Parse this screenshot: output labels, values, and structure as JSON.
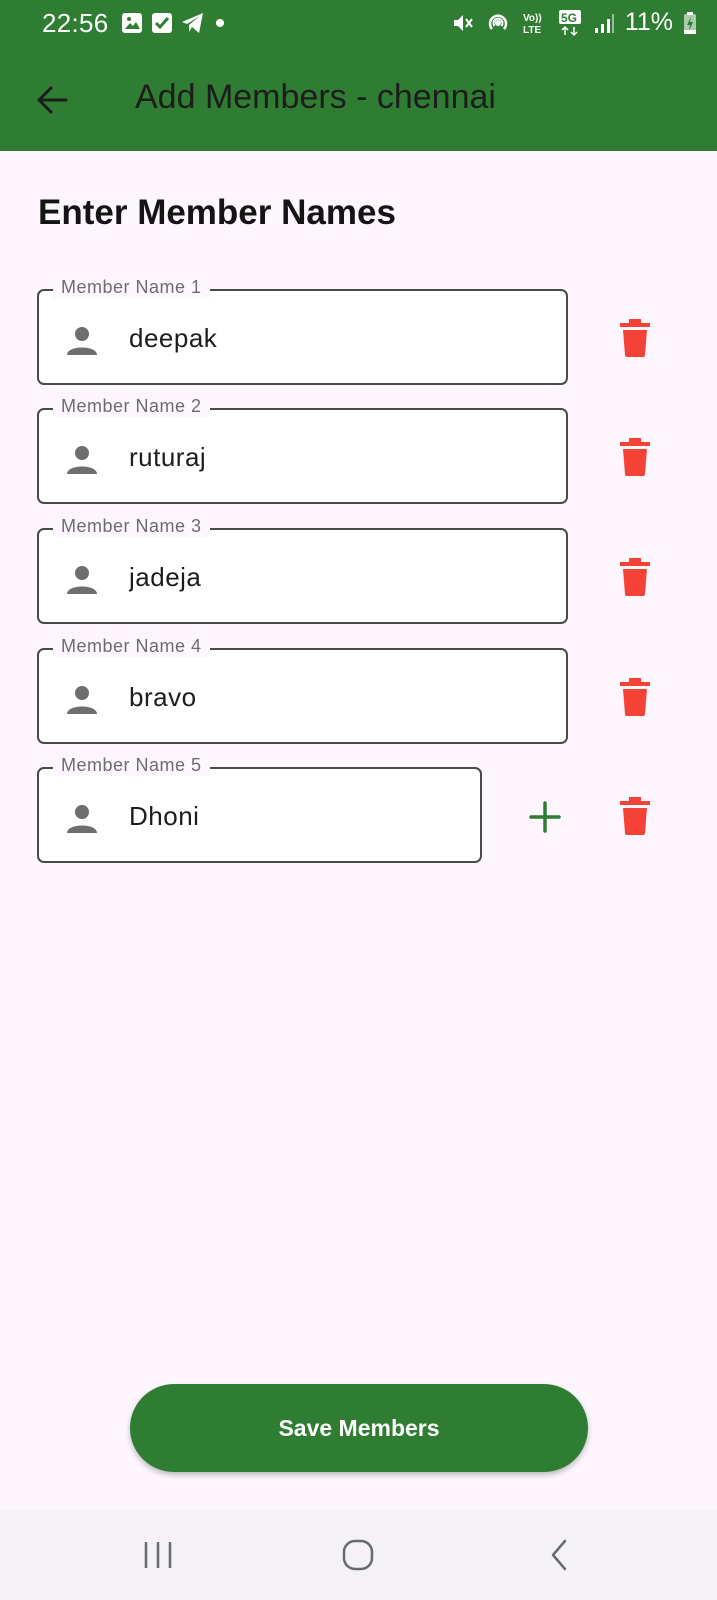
{
  "status_bar": {
    "time": "22:56",
    "left_icons": [
      "image-icon",
      "check-box-icon",
      "telegram-icon",
      "dot-icon"
    ],
    "right_icons": [
      "mute-vibrate-icon",
      "hotspot-icon",
      "volte-icon",
      "5g-icon",
      "signal-icon",
      "battery-charging-icon"
    ],
    "volte_label": "Vo)) LTE",
    "network_label": "5G",
    "battery": "11%"
  },
  "app_bar": {
    "title": "Add Members - chennai",
    "back_icon": "arrow-back-icon",
    "color": "#2f7d32"
  },
  "heading": "Enter Member Names",
  "members": [
    {
      "label": "Member Name 1",
      "value": "deepak"
    },
    {
      "label": "Member Name 2",
      "value": "ruturaj"
    },
    {
      "label": "Member Name 3",
      "value": "jadeja"
    },
    {
      "label": "Member Name 4",
      "value": "bravo"
    },
    {
      "label": "Member Name 5",
      "value": "Dhoni"
    }
  ],
  "icons": {
    "field_icon": "person-icon",
    "delete_icon": "delete-icon",
    "add_icon": "plus-icon",
    "delete_color": "#f44336",
    "add_color": "#2f7d32"
  },
  "save_button": {
    "label": "Save Members"
  },
  "nav_bar": {
    "items": [
      "recent-apps-icon",
      "home-icon",
      "back-icon"
    ]
  }
}
